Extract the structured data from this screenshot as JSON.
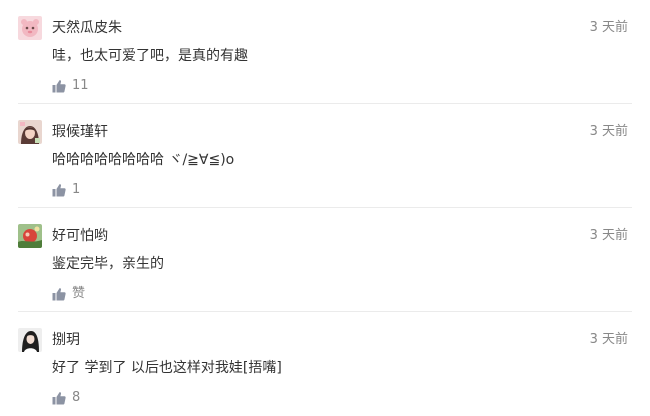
{
  "comments": [
    {
      "username": "天然瓜皮朱",
      "time": "3 天前",
      "content": "哇，也太可爱了吧，是真的有趣",
      "likes": "11",
      "avatar_icon": "pink-cartoon-avatar-icon"
    },
    {
      "username": "瑕候瑾轩",
      "time": "3 天前",
      "content": "哈哈哈哈哈哈哈哈 ヾ/≧∀≦)o",
      "likes": "1",
      "avatar_icon": "girl-photo-avatar-icon"
    },
    {
      "username": "好可怕哟",
      "time": "3 天前",
      "content": "鉴定完毕，亲生的",
      "likes": "赞",
      "avatar_icon": "red-green-avatar-icon"
    },
    {
      "username": "捌玥",
      "time": "3 天前",
      "content": "好了 学到了 以后也这样对我娃[捂嘴]",
      "likes": "8",
      "avatar_icon": "dark-hair-avatar-icon"
    }
  ],
  "colors": {
    "text": "#333333",
    "muted": "#888888",
    "divider": "#ebebeb",
    "thumb": "#8c93a3"
  }
}
